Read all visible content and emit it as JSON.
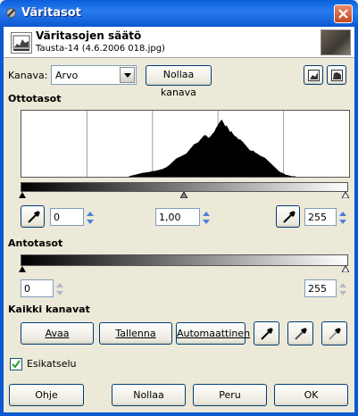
{
  "window": {
    "title": "Väritasot"
  },
  "header": {
    "title": "Väritasojen säätö",
    "subtitle": "Tausta-14 (4.6.2006 018.jpg)"
  },
  "channel": {
    "label": "Kanava:",
    "value": "Arvo",
    "reset_label": "Nollaa kanava"
  },
  "input_levels": {
    "section_label": "Ottotasot",
    "low": "0",
    "gamma": "1,00",
    "high": "255"
  },
  "output_levels": {
    "section_label": "Antotasot",
    "low": "0",
    "high": "255"
  },
  "all_channels": {
    "section_label": "Kaikki kanavat",
    "open_label": "Avaa",
    "save_label": "Tallenna",
    "auto_label": "Automaattinen"
  },
  "preview": {
    "label": "Esikatselu",
    "checked": true
  },
  "footer": {
    "help_label": "Ohje",
    "reset_label": "Nollaa",
    "cancel_label": "Peru",
    "ok_label": "OK"
  },
  "histogram": {
    "bins": [
      0,
      0,
      0,
      0,
      0,
      0,
      0,
      0,
      0,
      0,
      0,
      0,
      0,
      0,
      0,
      0,
      0,
      0,
      0,
      0,
      0,
      0,
      0,
      0,
      0,
      0,
      0,
      0,
      0,
      0,
      0,
      0,
      0,
      0,
      0,
      0,
      0,
      0,
      0,
      0,
      0,
      0,
      0,
      0,
      0,
      0,
      0,
      0,
      0,
      0,
      0,
      0,
      0,
      0,
      0,
      0,
      0,
      0,
      0,
      0,
      0,
      0,
      0,
      0,
      0,
      0,
      0,
      0,
      0,
      0,
      0,
      0,
      0,
      0,
      0,
      0,
      0,
      0,
      0,
      0,
      0,
      0,
      0,
      0,
      0,
      0,
      0,
      0,
      0,
      0,
      1,
      2,
      2,
      3,
      3,
      4,
      4,
      5,
      5,
      6,
      6,
      7,
      7,
      7,
      8,
      8,
      8,
      9,
      9,
      10,
      10,
      10,
      11,
      11,
      12,
      12,
      13,
      13,
      14,
      15,
      16,
      17,
      19,
      20,
      22,
      24,
      26,
      28,
      30,
      32,
      33,
      34,
      35,
      36,
      37,
      38,
      39,
      40,
      42,
      45,
      47,
      50,
      52,
      55,
      57,
      58,
      59,
      60,
      62,
      65,
      67,
      70,
      72,
      73,
      72,
      70,
      68,
      70,
      72,
      75,
      77,
      80,
      85,
      88,
      92,
      95,
      98,
      100,
      96,
      92,
      88,
      90,
      86,
      82,
      78,
      80,
      76,
      73,
      71,
      70,
      68,
      65,
      66,
      64,
      62,
      60,
      57,
      55,
      52,
      50,
      47,
      46,
      45,
      46,
      44,
      42,
      41,
      40,
      38,
      37,
      36,
      35,
      34,
      33,
      31,
      29,
      27,
      25,
      23,
      21,
      19,
      17,
      15,
      13,
      11,
      9,
      8,
      7,
      6,
      5,
      4,
      3,
      3,
      2,
      2,
      1,
      1,
      1,
      1,
      0,
      0,
      0,
      0,
      0,
      0,
      0,
      0,
      0,
      0,
      0,
      0,
      0,
      0,
      0,
      0,
      0,
      0,
      0,
      0,
      0,
      0,
      0,
      0,
      0,
      0,
      0,
      0,
      0,
      0,
      0,
      0,
      0,
      0,
      0,
      0,
      0,
      0,
      0,
      0,
      0,
      0,
      0,
      0,
      0
    ]
  }
}
